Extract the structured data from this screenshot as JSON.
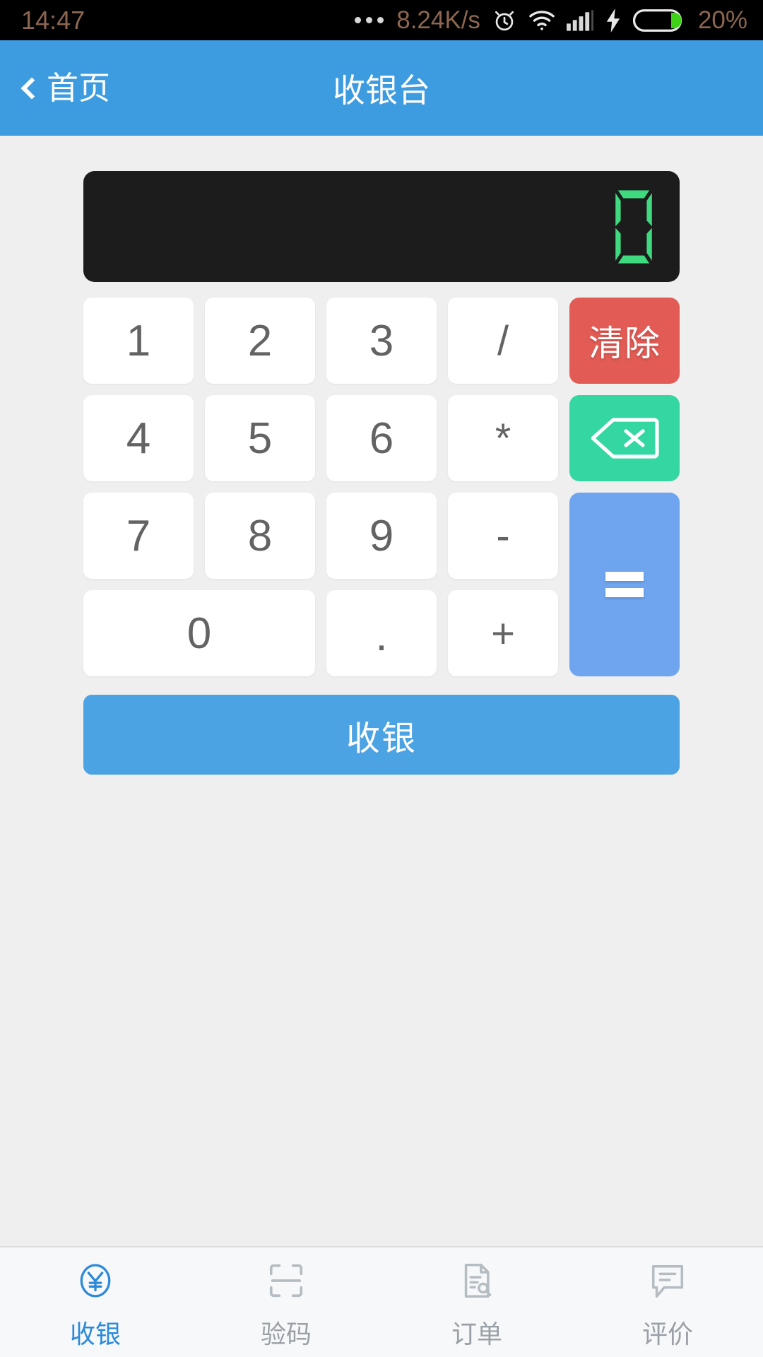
{
  "status_bar": {
    "time": "14:47",
    "more_icon": "ellipsis-icon",
    "network_speed": "8.24K/s",
    "alarm_icon": "alarm-clock-icon",
    "wifi_icon": "wifi-icon",
    "signal_icon": "cellular-signal-icon",
    "charging_icon": "charging-bolt-icon",
    "battery_icon": "battery-icon",
    "battery_percent": "20%",
    "text_color": "#8c6650",
    "battery_fill_color": "#3fd316"
  },
  "header": {
    "back_icon": "chevron-left-icon",
    "back_label": "首页",
    "title": "收银台",
    "bg_color": "#3d9be0"
  },
  "display": {
    "value": "0",
    "segment_color": "#3fd97f",
    "bg_color": "#1c1c1c"
  },
  "keypad": {
    "keys": [
      {
        "label": "1",
        "name": "key-1",
        "type": "digit"
      },
      {
        "label": "2",
        "name": "key-2",
        "type": "digit"
      },
      {
        "label": "3",
        "name": "key-3",
        "type": "digit"
      },
      {
        "label": "/",
        "name": "key-divide",
        "type": "operator"
      },
      {
        "label": "4",
        "name": "key-4",
        "type": "digit"
      },
      {
        "label": "5",
        "name": "key-5",
        "type": "digit"
      },
      {
        "label": "6",
        "name": "key-6",
        "type": "digit"
      },
      {
        "label": "*",
        "name": "key-multiply",
        "type": "operator"
      },
      {
        "label": "7",
        "name": "key-7",
        "type": "digit"
      },
      {
        "label": "8",
        "name": "key-8",
        "type": "digit"
      },
      {
        "label": "9",
        "name": "key-9",
        "type": "digit"
      },
      {
        "label": "-",
        "name": "key-minus",
        "type": "operator"
      },
      {
        "label": "0",
        "name": "key-0",
        "type": "digit"
      },
      {
        "label": ".",
        "name": "key-decimal",
        "type": "operator"
      },
      {
        "label": "+",
        "name": "key-plus",
        "type": "operator"
      }
    ],
    "clear_label": "清除",
    "clear_color": "#e25b54",
    "backspace_icon": "backspace-icon",
    "backspace_color": "#34d6a2",
    "equals_icon": "equals-icon",
    "equals_color": "#6ea5ee"
  },
  "pay_button": {
    "label": "收银",
    "color": "#4ba3e3"
  },
  "tabbar": {
    "active_color": "#2b8ad9",
    "inactive_color": "#9aa0a6",
    "items": [
      {
        "label": "收银",
        "icon": "yuan-circle-icon",
        "active": true
      },
      {
        "label": "验码",
        "icon": "scan-frame-icon",
        "active": false
      },
      {
        "label": "订单",
        "icon": "document-search-icon",
        "active": false
      },
      {
        "label": "评价",
        "icon": "comment-lines-icon",
        "active": false
      }
    ]
  }
}
